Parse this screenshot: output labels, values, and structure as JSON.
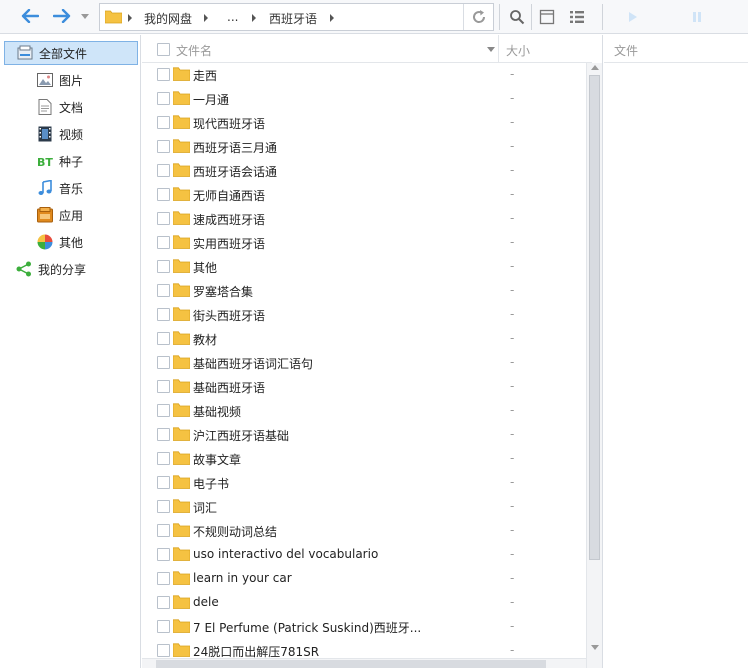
{
  "toolbar": {
    "breadcrumbs": [
      "我的网盘",
      "...",
      "西班牙语"
    ]
  },
  "sidebar": {
    "items": [
      {
        "label": "全部文件",
        "icon": "all-files-icon"
      },
      {
        "label": "图片",
        "icon": "image-icon"
      },
      {
        "label": "文档",
        "icon": "document-icon"
      },
      {
        "label": "视频",
        "icon": "video-icon"
      },
      {
        "label": "种子",
        "icon": "bt-icon"
      },
      {
        "label": "音乐",
        "icon": "music-icon"
      },
      {
        "label": "应用",
        "icon": "app-icon"
      },
      {
        "label": "其他",
        "icon": "other-icon"
      },
      {
        "label": "我的分享",
        "icon": "share-icon"
      }
    ]
  },
  "filelist": {
    "col_name": "文件名",
    "col_size": "大小",
    "files": [
      {
        "name": "走西",
        "size": "-"
      },
      {
        "name": "一月通",
        "size": "-"
      },
      {
        "name": "现代西班牙语",
        "size": "-"
      },
      {
        "name": "西班牙语三月通",
        "size": "-"
      },
      {
        "name": "西班牙语会话通",
        "size": "-"
      },
      {
        "name": "无师自通西语",
        "size": "-"
      },
      {
        "name": "速成西班牙语",
        "size": "-"
      },
      {
        "name": "实用西班牙语",
        "size": "-"
      },
      {
        "name": "其他",
        "size": "-"
      },
      {
        "name": "罗塞塔合集",
        "size": "-"
      },
      {
        "name": "街头西班牙语",
        "size": "-"
      },
      {
        "name": "教材",
        "size": "-"
      },
      {
        "name": "基础西班牙语词汇语句",
        "size": "-"
      },
      {
        "name": "基础西班牙语",
        "size": "-"
      },
      {
        "name": "基础视频",
        "size": "-"
      },
      {
        "name": "沪江西班牙语基础",
        "size": "-"
      },
      {
        "name": "故事文章",
        "size": "-"
      },
      {
        "name": "电子书",
        "size": "-"
      },
      {
        "name": "词汇",
        "size": "-"
      },
      {
        "name": "不规则动词总结",
        "size": "-"
      },
      {
        "name": "uso interactivo del vocabulario",
        "size": "-"
      },
      {
        "name": "learn in your car",
        "size": "-"
      },
      {
        "name": "dele",
        "size": "-"
      },
      {
        "name": "7 El Perfume (Patrick Suskind)西班牙...",
        "size": "-"
      },
      {
        "name": "24脱口而出解压781SR",
        "size": "-"
      }
    ]
  },
  "rightpanel": {
    "header": "文件"
  },
  "colors": {
    "accent_blue": "#3c8ddc",
    "folder_yellow": "#f5c242",
    "active_bg": "#cfe5f9"
  }
}
